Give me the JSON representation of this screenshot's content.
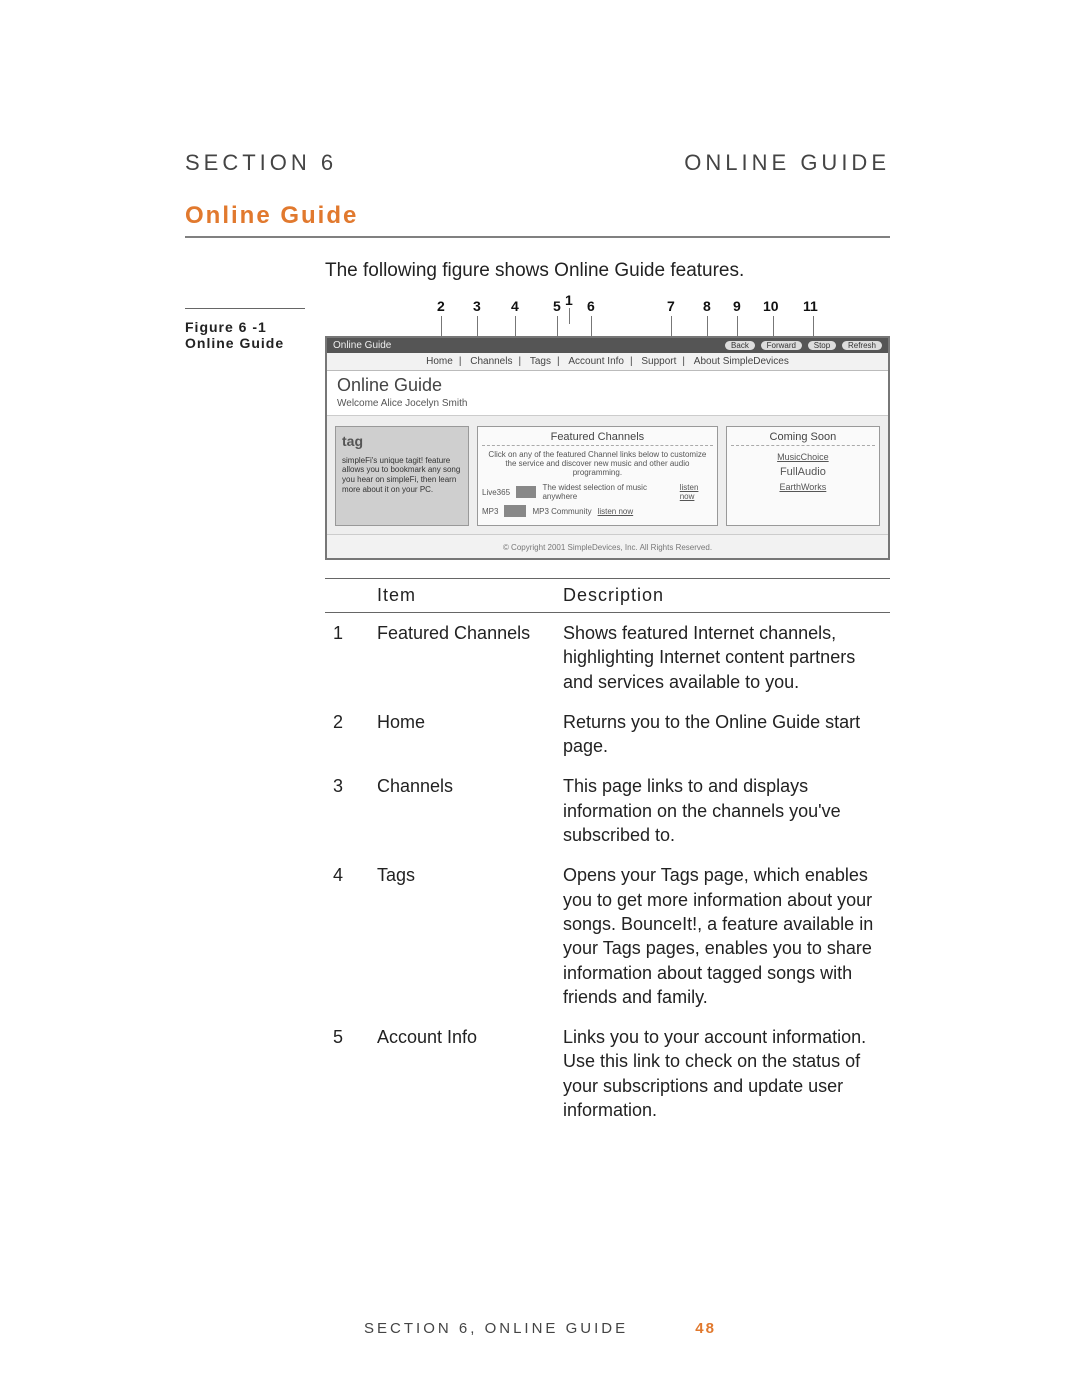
{
  "header": {
    "section_label": "SECTION 6",
    "right_label": "ONLINE GUIDE"
  },
  "heading": "Online Guide",
  "intro": "The following figure shows Online Guide features.",
  "figure_caption": {
    "line1": "Figure 6 -1",
    "line2": "Online Guide"
  },
  "callouts": {
    "n1": "1",
    "n2": "2",
    "n3": "3",
    "n4": "4",
    "n5": "5",
    "n6": "6",
    "n7": "7",
    "n8": "8",
    "n9": "9",
    "n10": "10",
    "n11": "11"
  },
  "screenshot": {
    "window_title": "Online Guide",
    "header_pills": {
      "a": "Back",
      "b": "Forward",
      "c": "Stop",
      "d": "Refresh"
    },
    "nav": {
      "home": "Home",
      "channels": "Channels",
      "tags": "Tags",
      "account": "Account Info",
      "support": "Support",
      "about": "About SimpleDevices"
    },
    "page_title": "Online Guide",
    "welcome": "Welcome Alice Jocelyn Smith",
    "tag_panel": {
      "title": "tag",
      "blurb": "simpleFi's unique tagit! feature allows you to bookmark any song you hear on simpleFi, then learn more about it on your PC."
    },
    "featured": {
      "title": "Featured Channels",
      "blurb": "Click on any of the featured Channel links below to customize the service and discover new music and other audio programming.",
      "row1_name": "Live365",
      "row1_desc": "The widest selection of music anywhere",
      "row1_link": "listen now",
      "row2_name": "MP3",
      "row2_desc": "MP3 Community",
      "row2_link": "listen now"
    },
    "coming_soon": {
      "title": "Coming Soon",
      "link1": "MusicChoice",
      "item2": "FullAudio",
      "link3": "EarthWorks"
    },
    "copyright": "© Copyright 2001 SimpleDevices, Inc. All Rights Reserved."
  },
  "table": {
    "head_item": "Item",
    "head_desc": "Description",
    "rows": [
      {
        "n": "1",
        "name": "Featured Channels",
        "desc": "Shows featured Internet channels, highlighting Internet content partners and services available to you."
      },
      {
        "n": "2",
        "name": "Home",
        "desc": "Returns you to the Online Guide start page."
      },
      {
        "n": "3",
        "name": "Channels",
        "desc": "This page links to and displays information on the channels you've subscribed to."
      },
      {
        "n": "4",
        "name": "Tags",
        "desc": "Opens your Tags page, which enables you to get more information about your songs. BounceIt!, a feature available in your Tags pages, enables you to share information about tagged songs with friends and family."
      },
      {
        "n": "5",
        "name": "Account Info",
        "desc": "Links you to your account information. Use this link to check on the status of your subscriptions and update user information."
      }
    ]
  },
  "footer": {
    "text": "SECTION 6, ONLINE GUIDE",
    "page": "48"
  }
}
